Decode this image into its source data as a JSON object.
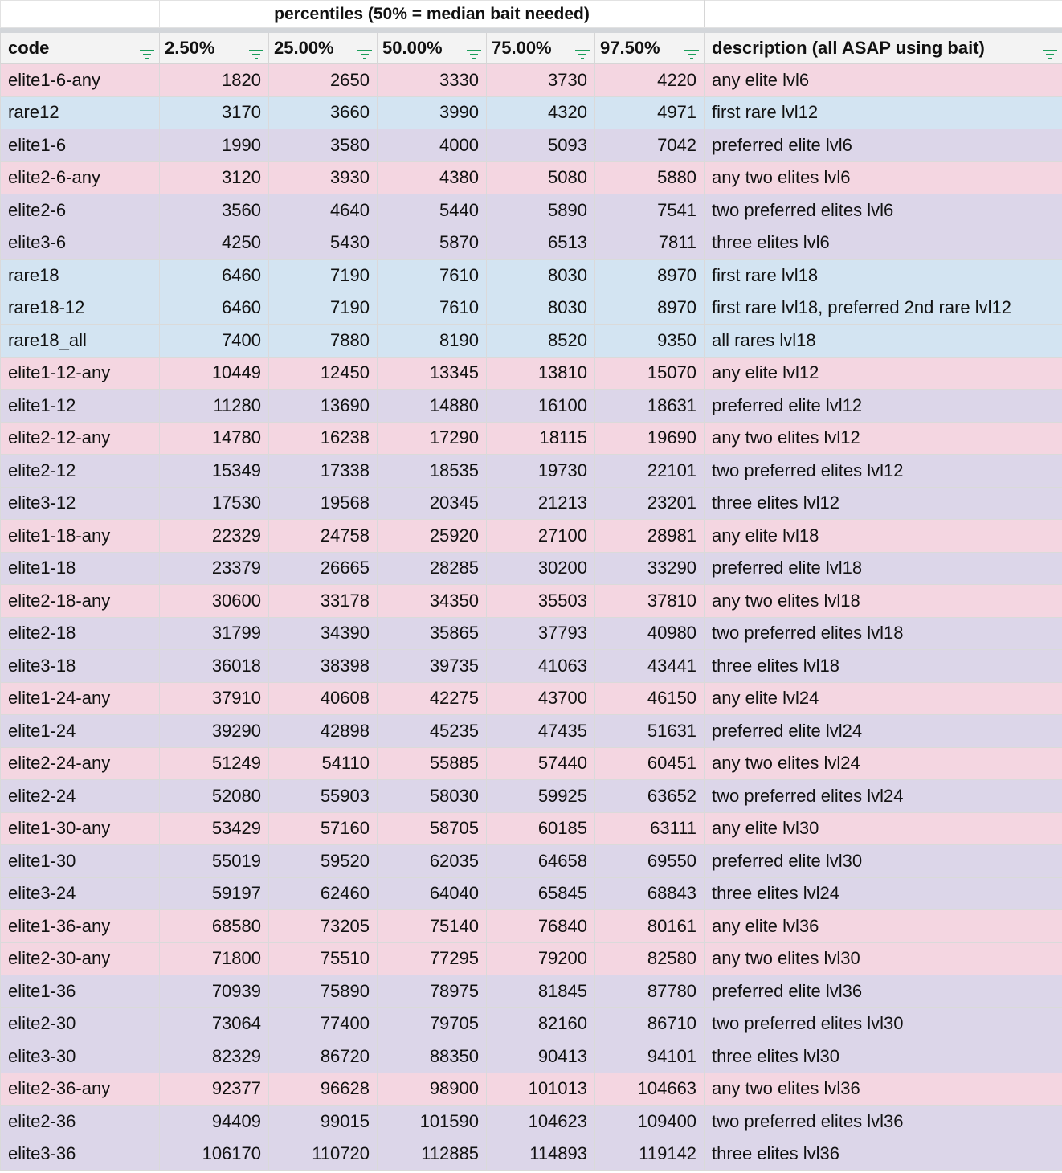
{
  "title": "percentiles (50% = median bait needed)",
  "headers": [
    "code",
    "2.50%",
    "25.00%",
    "50.00%",
    "75.00%",
    "97.50%",
    "description (all ASAP using bait)"
  ],
  "row_colors": {
    "pink": "#f4d6e1",
    "purple": "#dcd6e9",
    "blue": "#d3e4f2"
  },
  "filter_icon": "filter-icon",
  "rows": [
    {
      "code": "elite1-6-any",
      "p2_5": "1820",
      "p25": "2650",
      "p50": "3330",
      "p75": "3730",
      "p97_5": "4220",
      "desc": "any elite lvl6",
      "color": "pink"
    },
    {
      "code": "rare12",
      "p2_5": "3170",
      "p25": "3660",
      "p50": "3990",
      "p75": "4320",
      "p97_5": "4971",
      "desc": "first rare lvl12",
      "color": "blue"
    },
    {
      "code": "elite1-6",
      "p2_5": "1990",
      "p25": "3580",
      "p50": "4000",
      "p75": "5093",
      "p97_5": "7042",
      "desc": "preferred elite lvl6",
      "color": "purple"
    },
    {
      "code": "elite2-6-any",
      "p2_5": "3120",
      "p25": "3930",
      "p50": "4380",
      "p75": "5080",
      "p97_5": "5880",
      "desc": "any two elites lvl6",
      "color": "pink"
    },
    {
      "code": "elite2-6",
      "p2_5": "3560",
      "p25": "4640",
      "p50": "5440",
      "p75": "5890",
      "p97_5": "7541",
      "desc": "two preferred elites lvl6",
      "color": "purple"
    },
    {
      "code": "elite3-6",
      "p2_5": "4250",
      "p25": "5430",
      "p50": "5870",
      "p75": "6513",
      "p97_5": "7811",
      "desc": "three elites lvl6",
      "color": "purple"
    },
    {
      "code": "rare18",
      "p2_5": "6460",
      "p25": "7190",
      "p50": "7610",
      "p75": "8030",
      "p97_5": "8970",
      "desc": "first rare lvl18",
      "color": "blue"
    },
    {
      "code": "rare18-12",
      "p2_5": "6460",
      "p25": "7190",
      "p50": "7610",
      "p75": "8030",
      "p97_5": "8970",
      "desc": "first rare lvl18, preferred 2nd rare lvl12",
      "color": "blue"
    },
    {
      "code": "rare18_all",
      "p2_5": "7400",
      "p25": "7880",
      "p50": "8190",
      "p75": "8520",
      "p97_5": "9350",
      "desc": "all rares lvl18",
      "color": "blue"
    },
    {
      "code": "elite1-12-any",
      "p2_5": "10449",
      "p25": "12450",
      "p50": "13345",
      "p75": "13810",
      "p97_5": "15070",
      "desc": "any elite lvl12",
      "color": "pink"
    },
    {
      "code": "elite1-12",
      "p2_5": "11280",
      "p25": "13690",
      "p50": "14880",
      "p75": "16100",
      "p97_5": "18631",
      "desc": "preferred elite lvl12",
      "color": "purple"
    },
    {
      "code": "elite2-12-any",
      "p2_5": "14780",
      "p25": "16238",
      "p50": "17290",
      "p75": "18115",
      "p97_5": "19690",
      "desc": "any two elites lvl12",
      "color": "pink"
    },
    {
      "code": "elite2-12",
      "p2_5": "15349",
      "p25": "17338",
      "p50": "18535",
      "p75": "19730",
      "p97_5": "22101",
      "desc": "two preferred elites lvl12",
      "color": "purple"
    },
    {
      "code": "elite3-12",
      "p2_5": "17530",
      "p25": "19568",
      "p50": "20345",
      "p75": "21213",
      "p97_5": "23201",
      "desc": "three elites lvl12",
      "color": "purple"
    },
    {
      "code": "elite1-18-any",
      "p2_5": "22329",
      "p25": "24758",
      "p50": "25920",
      "p75": "27100",
      "p97_5": "28981",
      "desc": "any elite lvl18",
      "color": "pink"
    },
    {
      "code": "elite1-18",
      "p2_5": "23379",
      "p25": "26665",
      "p50": "28285",
      "p75": "30200",
      "p97_5": "33290",
      "desc": "preferred elite lvl18",
      "color": "purple"
    },
    {
      "code": "elite2-18-any",
      "p2_5": "30600",
      "p25": "33178",
      "p50": "34350",
      "p75": "35503",
      "p97_5": "37810",
      "desc": "any two elites lvl18",
      "color": "pink"
    },
    {
      "code": "elite2-18",
      "p2_5": "31799",
      "p25": "34390",
      "p50": "35865",
      "p75": "37793",
      "p97_5": "40980",
      "desc": "two preferred elites lvl18",
      "color": "purple"
    },
    {
      "code": "elite3-18",
      "p2_5": "36018",
      "p25": "38398",
      "p50": "39735",
      "p75": "41063",
      "p97_5": "43441",
      "desc": "three elites lvl18",
      "color": "purple"
    },
    {
      "code": "elite1-24-any",
      "p2_5": "37910",
      "p25": "40608",
      "p50": "42275",
      "p75": "43700",
      "p97_5": "46150",
      "desc": "any elite lvl24",
      "color": "pink"
    },
    {
      "code": "elite1-24",
      "p2_5": "39290",
      "p25": "42898",
      "p50": "45235",
      "p75": "47435",
      "p97_5": "51631",
      "desc": "preferred elite lvl24",
      "color": "purple"
    },
    {
      "code": "elite2-24-any",
      "p2_5": "51249",
      "p25": "54110",
      "p50": "55885",
      "p75": "57440",
      "p97_5": "60451",
      "desc": "any two elites lvl24",
      "color": "pink"
    },
    {
      "code": "elite2-24",
      "p2_5": "52080",
      "p25": "55903",
      "p50": "58030",
      "p75": "59925",
      "p97_5": "63652",
      "desc": "two preferred elites lvl24",
      "color": "purple"
    },
    {
      "code": "elite1-30-any",
      "p2_5": "53429",
      "p25": "57160",
      "p50": "58705",
      "p75": "60185",
      "p97_5": "63111",
      "desc": "any elite lvl30",
      "color": "pink"
    },
    {
      "code": "elite1-30",
      "p2_5": "55019",
      "p25": "59520",
      "p50": "62035",
      "p75": "64658",
      "p97_5": "69550",
      "desc": "preferred elite lvl30",
      "color": "purple"
    },
    {
      "code": "elite3-24",
      "p2_5": "59197",
      "p25": "62460",
      "p50": "64040",
      "p75": "65845",
      "p97_5": "68843",
      "desc": "three elites lvl24",
      "color": "purple"
    },
    {
      "code": "elite1-36-any",
      "p2_5": "68580",
      "p25": "73205",
      "p50": "75140",
      "p75": "76840",
      "p97_5": "80161",
      "desc": "any elite lvl36",
      "color": "pink"
    },
    {
      "code": "elite2-30-any",
      "p2_5": "71800",
      "p25": "75510",
      "p50": "77295",
      "p75": "79200",
      "p97_5": "82580",
      "desc": "any two elites lvl30",
      "color": "pink"
    },
    {
      "code": "elite1-36",
      "p2_5": "70939",
      "p25": "75890",
      "p50": "78975",
      "p75": "81845",
      "p97_5": "87780",
      "desc": "preferred elite lvl36",
      "color": "purple"
    },
    {
      "code": "elite2-30",
      "p2_5": "73064",
      "p25": "77400",
      "p50": "79705",
      "p75": "82160",
      "p97_5": "86710",
      "desc": "two preferred elites lvl30",
      "color": "purple"
    },
    {
      "code": "elite3-30",
      "p2_5": "82329",
      "p25": "86720",
      "p50": "88350",
      "p75": "90413",
      "p97_5": "94101",
      "desc": "three elites lvl30",
      "color": "purple"
    },
    {
      "code": "elite2-36-any",
      "p2_5": "92377",
      "p25": "96628",
      "p50": "98900",
      "p75": "101013",
      "p97_5": "104663",
      "desc": "any two elites lvl36",
      "color": "pink"
    },
    {
      "code": "elite2-36",
      "p2_5": "94409",
      "p25": "99015",
      "p50": "101590",
      "p75": "104623",
      "p97_5": "109400",
      "desc": "two preferred elites lvl36",
      "color": "purple"
    },
    {
      "code": "elite3-36",
      "p2_5": "106170",
      "p25": "110720",
      "p50": "112885",
      "p75": "114893",
      "p97_5": "119142",
      "desc": "three elites lvl36",
      "color": "purple"
    }
  ]
}
